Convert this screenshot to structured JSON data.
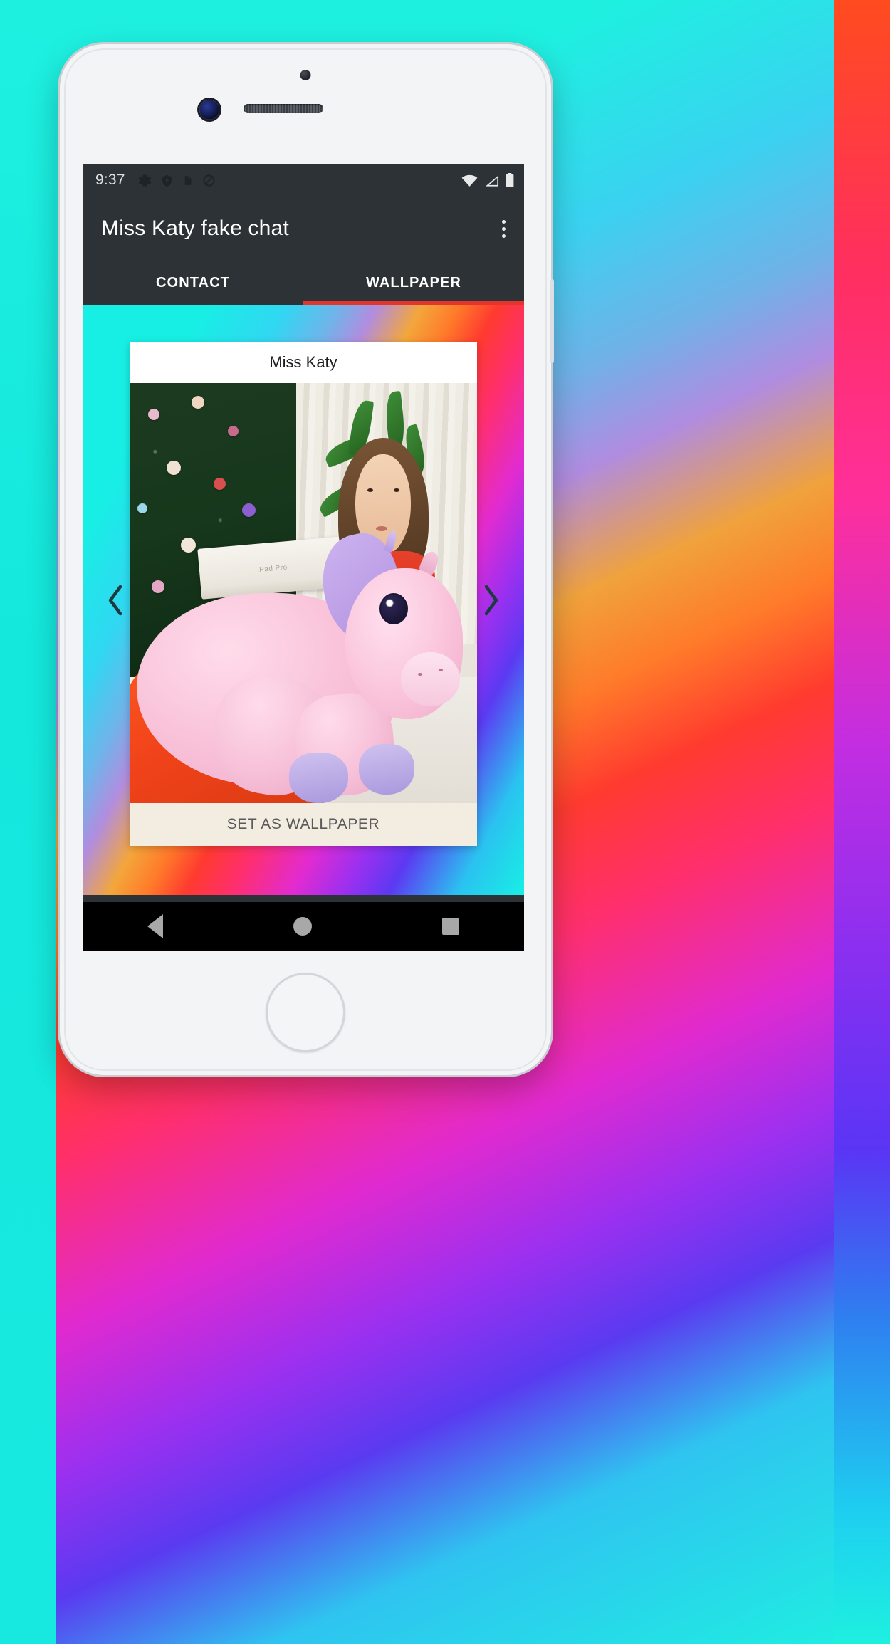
{
  "status_bar": {
    "time": "9:37",
    "left_icons": [
      "gear-icon",
      "play-protect-shield-icon",
      "sd-card-icon",
      "do-not-disturb-icon"
    ],
    "right_icons": [
      "wifi-icon",
      "cellular-signal-icon",
      "battery-icon"
    ]
  },
  "app_bar": {
    "title": "Miss Katy fake chat",
    "overflow_icon": "kebab-menu-icon"
  },
  "tabs": {
    "items": [
      {
        "label": "CONTACT",
        "active": false
      },
      {
        "label": "WALLPAPER",
        "active": true
      }
    ],
    "indicator_color": "#e5342b"
  },
  "carousel": {
    "prev_icon": "chevron-left-icon",
    "next_icon": "chevron-right-icon"
  },
  "wallpaper_card": {
    "title": "Miss Katy",
    "action_label": "SET AS WALLPAPER",
    "action_bg": "#f2ece1",
    "photo_alt_elements": {
      "box_label": "iPad Pro"
    }
  },
  "nav_bar": {
    "back_icon": "triangle-back-icon",
    "home_icon": "circle-home-icon",
    "recents_icon": "square-recents-icon"
  },
  "theme": {
    "app_bar_bg": "#2c3235",
    "card_bg": "#ffffff"
  }
}
